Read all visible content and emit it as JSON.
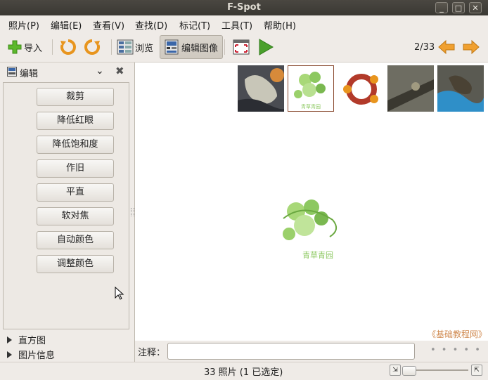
{
  "window": {
    "title": "F-Spot",
    "controls": [
      "_",
      "□",
      "✕"
    ]
  },
  "menu": [
    {
      "label": "照片(P)"
    },
    {
      "label": "编辑(E)"
    },
    {
      "label": "查看(V)"
    },
    {
      "label": "查找(D)"
    },
    {
      "label": "标记(T)"
    },
    {
      "label": "工具(T)"
    },
    {
      "label": "帮助(H)"
    }
  ],
  "toolbar": {
    "import_label": "导入",
    "browse_label": "浏览",
    "edit_image_label": "编辑图像",
    "position": "2/33",
    "icons": [
      "plus-icon",
      "rotate-left-icon",
      "rotate-right-icon",
      "browse-icon",
      "edit-image-icon",
      "fullscreen-icon",
      "play-icon",
      "arrow-left-icon",
      "arrow-right-icon"
    ]
  },
  "sidebar": {
    "header_label": "编辑",
    "tools": [
      "裁剪",
      "降低红眼",
      "降低饱和度",
      "作旧",
      "平直",
      "软对焦",
      "自动颜色",
      "调整颜色"
    ],
    "expanders": [
      "直方图",
      "图片信息"
    ]
  },
  "main": {
    "watermark": "青草青园",
    "thumb_caption": "青草青园",
    "site_credit": "《基础教程网》",
    "comment_label": "注释：",
    "comment_value": "",
    "dots": "• • • • •"
  },
  "status": {
    "text": "33 照片 (1 已选定)"
  },
  "colors": {
    "titlebar": "#3e3c37",
    "accent_orange": "#f0a030",
    "play_green": "#4aa02c",
    "leaf_green": "#8cc860"
  }
}
